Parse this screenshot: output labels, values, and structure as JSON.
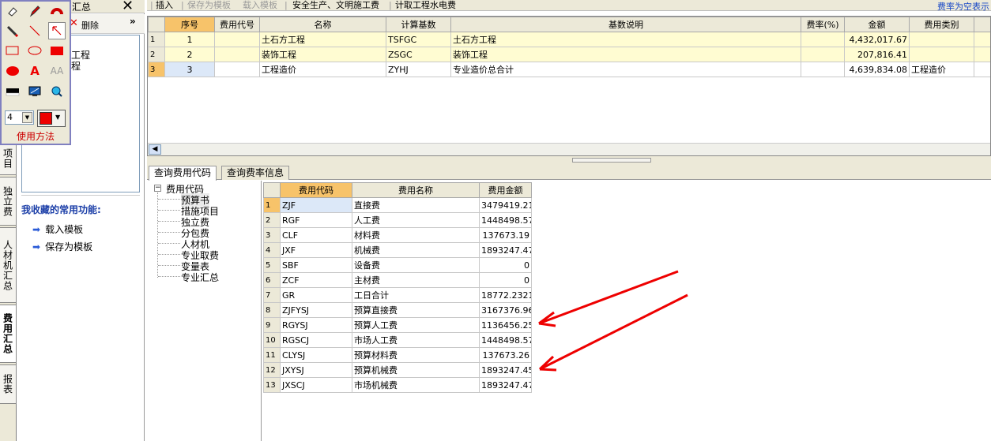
{
  "colors": {
    "accent_orange": "#f7c36a",
    "row_yellow": "#fffcd2",
    "arrow_red": "#e00000",
    "link_blue": "#1646c6"
  },
  "vertical_tabs": [
    "项目",
    "独立费",
    "人材机汇总",
    "费用汇总",
    "报表"
  ],
  "active_vertical_tab": "费用汇总",
  "left_panel": {
    "title_partial": "汇总",
    "delete_label": "删除",
    "tree_items": [
      "工程",
      "程"
    ],
    "favorites_title": "我收藏的常用功能:",
    "favorites": [
      "载入模板",
      "保存为模板"
    ]
  },
  "palette": {
    "tools": [
      "eraser-icon",
      "pen-icon",
      "magnet-icon",
      "pencil-icon",
      "line-icon",
      "arrow-icon",
      "rect-outline-icon",
      "ellipse-outline-icon",
      "rect-filled-icon",
      "ellipse-filled-icon",
      "text-a-icon",
      "text-aa-icon",
      "highlight-bar-icon",
      "screen-icon",
      "zoom-icon"
    ],
    "size_value": "4",
    "color_value": "#e00000",
    "usage_label": "使用方法"
  },
  "toolbar": {
    "insert": "插入",
    "save_template": "保存为模板",
    "load_template": "载入模板",
    "safety": "安全生产、文明施工费",
    "water_elec": "计取工程水电费",
    "right_hint": "费率为空表示"
  },
  "grid1": {
    "headers": [
      "序号",
      "费用代号",
      "名称",
      "计算基数",
      "基数说明",
      "费率(%)",
      "金额",
      "费用类别"
    ],
    "rows": [
      {
        "rn": "1",
        "seq": "1",
        "code": "",
        "name": "土石方工程",
        "base": "TSFGC",
        "desc": "土石方工程",
        "rate": "",
        "amount": "4,432,017.67",
        "cat": ""
      },
      {
        "rn": "2",
        "seq": "2",
        "code": "",
        "name": "装饰工程",
        "base": "ZSGC",
        "desc": "装饰工程",
        "rate": "",
        "amount": "207,816.41",
        "cat": ""
      },
      {
        "rn": "3",
        "seq": "3",
        "code": "",
        "name": "工程造价",
        "base": "ZYHJ",
        "desc": "专业造价总合计",
        "rate": "",
        "amount": "4,639,834.08",
        "cat": "工程造价"
      }
    ]
  },
  "lower_tabs": [
    "查询费用代码",
    "查询费率信息"
  ],
  "tree2": {
    "root": "费用代码",
    "children": [
      "预算书",
      "措施项目",
      "独立费",
      "分包费",
      "人材机",
      "专业取费",
      "变量表",
      "专业汇总"
    ]
  },
  "grid2": {
    "headers": [
      "费用代码",
      "费用名称",
      "费用金额"
    ],
    "rows": [
      [
        "1",
        "ZJF",
        "直接费",
        "3479419.21"
      ],
      [
        "2",
        "RGF",
        "人工费",
        "1448498.57"
      ],
      [
        "3",
        "CLF",
        "材料费",
        "137673.19"
      ],
      [
        "4",
        "JXF",
        "机械费",
        "1893247.47"
      ],
      [
        "5",
        "SBF",
        "设备费",
        "0"
      ],
      [
        "6",
        "ZCF",
        "主材费",
        "0"
      ],
      [
        "7",
        "GR",
        "工日合计",
        "18772.2321"
      ],
      [
        "8",
        "ZJFYSJ",
        "预算直接费",
        "3167376.96"
      ],
      [
        "9",
        "RGYSJ",
        "预算人工费",
        "1136456.25"
      ],
      [
        "10",
        "RGSCJ",
        "市场人工费",
        "1448498.57"
      ],
      [
        "11",
        "CLYSJ",
        "预算材料费",
        "137673.26"
      ],
      [
        "12",
        "JXYSJ",
        "预算机械费",
        "1893247.45"
      ],
      [
        "13",
        "JXSCJ",
        "市场机械费",
        "1893247.47"
      ]
    ]
  }
}
